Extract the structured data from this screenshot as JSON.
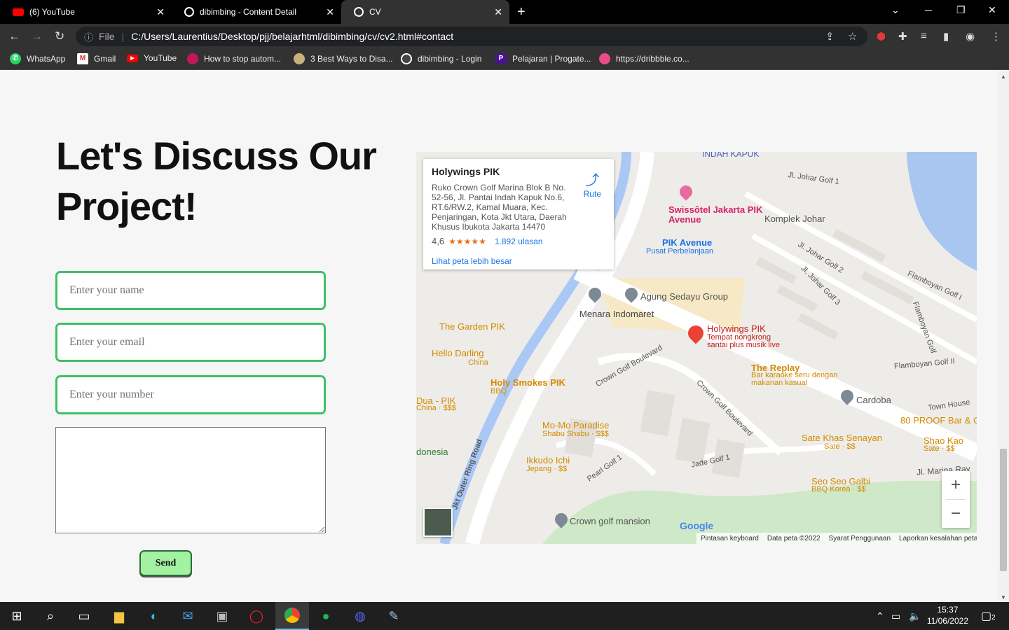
{
  "tabs": [
    {
      "title": "(6) YouTube",
      "close": "✕"
    },
    {
      "title": "dibimbing - Content Detail",
      "close": "✕"
    },
    {
      "title": "CV",
      "close": "✕"
    }
  ],
  "new_tab": "+",
  "address": {
    "file_label": "File",
    "url": "C:/Users/Laurentius/Desktop/pjj/belajarhtml/dibimbing/cv/cv2.html#contact"
  },
  "bookmarks": [
    "WhatsApp",
    "Gmail",
    "YouTube",
    "How to stop autom...",
    "3 Best Ways to Disa...",
    "dibimbing - Login",
    "Pelajaran | Progate...",
    "https://dribbble.co..."
  ],
  "page": {
    "heading": "Let's Discuss Our Project!",
    "name_placeholder": "Enter your name",
    "email_placeholder": "Enter your email",
    "number_placeholder": "Enter your number",
    "send_label": "Send"
  },
  "map": {
    "place_name": "Holywings PIK",
    "address": "Ruko Crown Golf Marina Blok B No. 52-56, Jl. Pantai Indah Kapuk No.6, RT.6/RW.2, Kamal Muara, Kec. Penjaringan, Kota Jkt Utara, Daerah Khusus Ibukota Jakarta 14470",
    "rating": "4,6",
    "stars": "★★★★★",
    "reviews": "1.892 ulasan",
    "route": "Rute",
    "view_larger": "Lihat peta lebih besar",
    "labels": {
      "indah_kapuk": "INDAH KAPUK",
      "swissotel": "Swissôtel Jakarta PIK Avenue",
      "komplek_johar": "Komplek Johar",
      "pik_avenue": "PIK Avenue",
      "pusat": "Pusat Perbelanjaan",
      "agung": "Agung Sedayu Group",
      "menara": "Menara Indomaret",
      "holywings": "Holywings PIK",
      "holywings_sub": "Tempat nongkrong santai plus musik live",
      "garden": "The Garden PIK",
      "hello": "Hello Darling",
      "hello_sub": "China",
      "holy_smokes": "Holy Smokes PIK",
      "holy_smokes_sub": "BBQ",
      "replay": "The Replay",
      "replay_sub": "Bar karaoke seru dengan makanan kasual",
      "cardoba": "Cardoba",
      "dua": "Dua - PIK",
      "dua_sub": "China · $$$",
      "momo": "Mo-Mo Paradise",
      "momo_sub": "Shabu Shabu · $$$",
      "ikkudo": "Ikkudo Ichi",
      "ikkudo_sub": "Jepang · $$",
      "sate": "Sate Khas Senayan",
      "sate_sub": "Sate · $$",
      "shao": "Shao Kao",
      "shao_sub": "Sate · $$",
      "proof": "80 PROOF Bar & C",
      "seo": "Seo Seo Galbi",
      "seo_sub": "BBQ Korea · $$",
      "crown_mansion": "Crown golf mansion",
      "donesia": "donesia"
    },
    "roads": {
      "johar1": "Jl. Johar Golf 1",
      "johar2": "Jl. Johar Golf 2",
      "johar3": "Jl. Johar Golf 3",
      "flamboyan1": "Flamboyan Golf I",
      "flamboyan2": "Flamboyan Golf II",
      "flamboyan": "Flamboyan Golf",
      "crown_blvd": "Crown Golf Boulevard",
      "crown_blvd2": "Crown Golf Boulevard",
      "outer_ring": "Jkt Outer Ring Road",
      "pearl": "Pearl Golf 1",
      "jade": "Jade Golf 1",
      "townhouse": "Town House",
      "marina": "Jl. Marina Ray"
    },
    "zoom_in": "+",
    "zoom_out": "−",
    "google": "Google",
    "footer": [
      "Pintasan keyboard",
      "Data peta ©2022",
      "Syarat Penggunaan",
      "Laporkan kesalahan peta"
    ]
  },
  "taskbar": {
    "time": "15:37",
    "date": "11/06/2022",
    "notif": "2"
  },
  "colors": {
    "accent_green": "#3fbf6a",
    "send_bg": "#a3f2a1"
  }
}
